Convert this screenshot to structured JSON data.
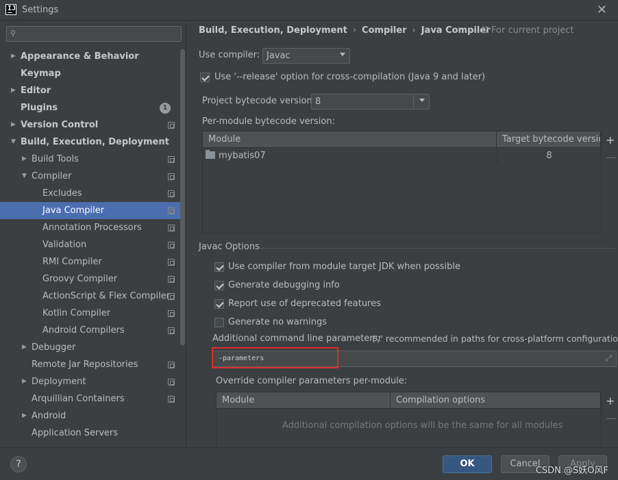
{
  "window": {
    "title": "Settings"
  },
  "search": {
    "placeholder": ""
  },
  "sidebar": {
    "items": [
      {
        "label": "Appearance & Behavior"
      },
      {
        "label": "Keymap"
      },
      {
        "label": "Editor"
      },
      {
        "label": "Plugins",
        "badge": "1"
      },
      {
        "label": "Version Control"
      },
      {
        "label": "Build, Execution, Deployment"
      },
      {
        "label": "Build Tools"
      },
      {
        "label": "Compiler"
      },
      {
        "label": "Excludes"
      },
      {
        "label": "Java Compiler"
      },
      {
        "label": "Annotation Processors"
      },
      {
        "label": "Validation"
      },
      {
        "label": "RMI Compiler"
      },
      {
        "label": "Groovy Compiler"
      },
      {
        "label": "ActionScript & Flex Compiler"
      },
      {
        "label": "Kotlin Compiler"
      },
      {
        "label": "Android Compilers"
      },
      {
        "label": "Debugger"
      },
      {
        "label": "Remote Jar Repositories"
      },
      {
        "label": "Deployment"
      },
      {
        "label": "Arquillian Containers"
      },
      {
        "label": "Android"
      },
      {
        "label": "Application Servers"
      }
    ]
  },
  "breadcrumb": {
    "part1": "Build, Execution, Deployment",
    "part2": "Compiler",
    "part3": "Java Compiler",
    "separator": "›"
  },
  "for_project": "For current project",
  "compiler": {
    "use_compiler_label": "Use compiler:",
    "use_compiler_value": "Javac",
    "release_option_label": "Use '--release' option for cross-compilation (Java 9 and later)",
    "release_option_checked": true,
    "project_bytecode_label": "Project bytecode version:",
    "project_bytecode_value": "8",
    "per_module_label": "Per-module bytecode version:"
  },
  "module_table": {
    "headers": [
      "Module",
      "Target bytecode version"
    ],
    "rows": [
      {
        "module": "mybatis07",
        "version": "8"
      }
    ],
    "add": "+",
    "remove": "—"
  },
  "javac": {
    "group_title": "Javac Options",
    "options": [
      {
        "label": "Use compiler from module target JDK when possible",
        "checked": true
      },
      {
        "label": "Generate debugging info",
        "checked": true
      },
      {
        "label": "Report use of deprecated features",
        "checked": true
      },
      {
        "label": "Generate no warnings",
        "checked": false
      }
    ],
    "additional_label": "Additional command line parameters:",
    "additional_hint": "('/' recommended in paths for cross-platform configurations)",
    "additional_value": "-parameters",
    "override_label": "Override compiler parameters per-module:"
  },
  "override_table": {
    "headers": [
      "Module",
      "Compilation options"
    ],
    "empty_text": "Additional compilation options will be the same for all modules",
    "add": "+",
    "remove": "—"
  },
  "footer": {
    "help": "?",
    "ok": "OK",
    "cancel": "Cancel",
    "apply": "Apply",
    "watermark": "CSDN @S妖O风F"
  },
  "colors": {
    "selection": "#4b6eaf",
    "background": "#3c3f41",
    "highlight_box": "#e12a2a",
    "ok_button": "#365880"
  }
}
